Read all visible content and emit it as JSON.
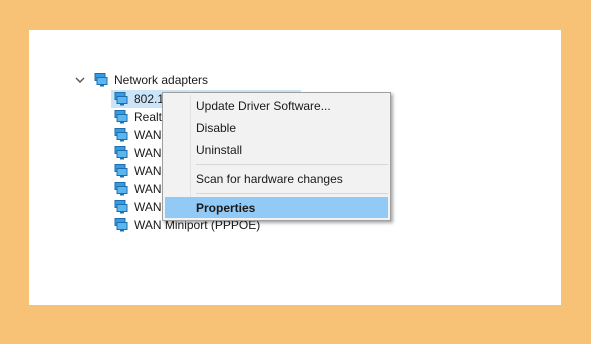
{
  "device_manager": {
    "category": {
      "label": "Network adapters",
      "expanded": true
    },
    "adapters": [
      {
        "label": "802.1"
      },
      {
        "label": "Realte"
      },
      {
        "label": "WAN"
      },
      {
        "label": "WAN"
      },
      {
        "label": "WAN"
      },
      {
        "label": "WAN"
      },
      {
        "label": "WAN"
      },
      {
        "label": "WAN Miniport (PPPOE)"
      }
    ]
  },
  "context_menu": {
    "update_driver": "Update Driver Software...",
    "disable": "Disable",
    "uninstall": "Uninstall",
    "scan": "Scan for hardware changes",
    "properties": "Properties"
  },
  "colors": {
    "background": "#F7C275",
    "selection": "#CCE4F7",
    "menu_highlight": "#91C9F7"
  }
}
